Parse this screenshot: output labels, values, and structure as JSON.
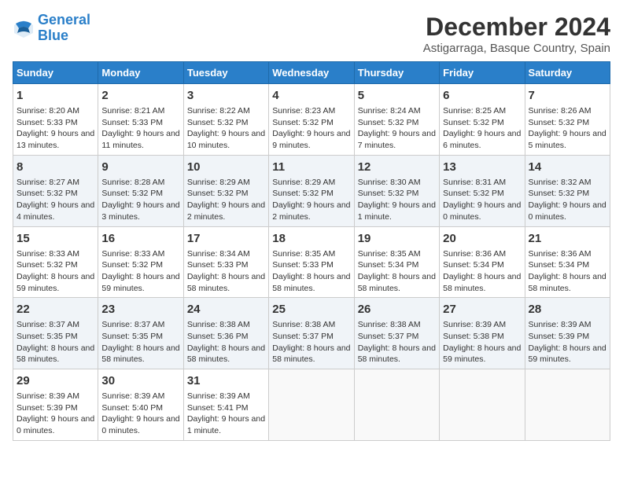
{
  "logo": {
    "line1": "General",
    "line2": "Blue"
  },
  "title": "December 2024",
  "subtitle": "Astigarraga, Basque Country, Spain",
  "headers": [
    "Sunday",
    "Monday",
    "Tuesday",
    "Wednesday",
    "Thursday",
    "Friday",
    "Saturday"
  ],
  "weeks": [
    [
      {
        "day": "1",
        "sunrise": "Sunrise: 8:20 AM",
        "sunset": "Sunset: 5:33 PM",
        "daylight": "Daylight: 9 hours and 13 minutes."
      },
      {
        "day": "2",
        "sunrise": "Sunrise: 8:21 AM",
        "sunset": "Sunset: 5:33 PM",
        "daylight": "Daylight: 9 hours and 11 minutes."
      },
      {
        "day": "3",
        "sunrise": "Sunrise: 8:22 AM",
        "sunset": "Sunset: 5:32 PM",
        "daylight": "Daylight: 9 hours and 10 minutes."
      },
      {
        "day": "4",
        "sunrise": "Sunrise: 8:23 AM",
        "sunset": "Sunset: 5:32 PM",
        "daylight": "Daylight: 9 hours and 9 minutes."
      },
      {
        "day": "5",
        "sunrise": "Sunrise: 8:24 AM",
        "sunset": "Sunset: 5:32 PM",
        "daylight": "Daylight: 9 hours and 7 minutes."
      },
      {
        "day": "6",
        "sunrise": "Sunrise: 8:25 AM",
        "sunset": "Sunset: 5:32 PM",
        "daylight": "Daylight: 9 hours and 6 minutes."
      },
      {
        "day": "7",
        "sunrise": "Sunrise: 8:26 AM",
        "sunset": "Sunset: 5:32 PM",
        "daylight": "Daylight: 9 hours and 5 minutes."
      }
    ],
    [
      {
        "day": "8",
        "sunrise": "Sunrise: 8:27 AM",
        "sunset": "Sunset: 5:32 PM",
        "daylight": "Daylight: 9 hours and 4 minutes."
      },
      {
        "day": "9",
        "sunrise": "Sunrise: 8:28 AM",
        "sunset": "Sunset: 5:32 PM",
        "daylight": "Daylight: 9 hours and 3 minutes."
      },
      {
        "day": "10",
        "sunrise": "Sunrise: 8:29 AM",
        "sunset": "Sunset: 5:32 PM",
        "daylight": "Daylight: 9 hours and 2 minutes."
      },
      {
        "day": "11",
        "sunrise": "Sunrise: 8:29 AM",
        "sunset": "Sunset: 5:32 PM",
        "daylight": "Daylight: 9 hours and 2 minutes."
      },
      {
        "day": "12",
        "sunrise": "Sunrise: 8:30 AM",
        "sunset": "Sunset: 5:32 PM",
        "daylight": "Daylight: 9 hours and 1 minute."
      },
      {
        "day": "13",
        "sunrise": "Sunrise: 8:31 AM",
        "sunset": "Sunset: 5:32 PM",
        "daylight": "Daylight: 9 hours and 0 minutes."
      },
      {
        "day": "14",
        "sunrise": "Sunrise: 8:32 AM",
        "sunset": "Sunset: 5:32 PM",
        "daylight": "Daylight: 9 hours and 0 minutes."
      }
    ],
    [
      {
        "day": "15",
        "sunrise": "Sunrise: 8:33 AM",
        "sunset": "Sunset: 5:32 PM",
        "daylight": "Daylight: 8 hours and 59 minutes."
      },
      {
        "day": "16",
        "sunrise": "Sunrise: 8:33 AM",
        "sunset": "Sunset: 5:32 PM",
        "daylight": "Daylight: 8 hours and 59 minutes."
      },
      {
        "day": "17",
        "sunrise": "Sunrise: 8:34 AM",
        "sunset": "Sunset: 5:33 PM",
        "daylight": "Daylight: 8 hours and 58 minutes."
      },
      {
        "day": "18",
        "sunrise": "Sunrise: 8:35 AM",
        "sunset": "Sunset: 5:33 PM",
        "daylight": "Daylight: 8 hours and 58 minutes."
      },
      {
        "day": "19",
        "sunrise": "Sunrise: 8:35 AM",
        "sunset": "Sunset: 5:34 PM",
        "daylight": "Daylight: 8 hours and 58 minutes."
      },
      {
        "day": "20",
        "sunrise": "Sunrise: 8:36 AM",
        "sunset": "Sunset: 5:34 PM",
        "daylight": "Daylight: 8 hours and 58 minutes."
      },
      {
        "day": "21",
        "sunrise": "Sunrise: 8:36 AM",
        "sunset": "Sunset: 5:34 PM",
        "daylight": "Daylight: 8 hours and 58 minutes."
      }
    ],
    [
      {
        "day": "22",
        "sunrise": "Sunrise: 8:37 AM",
        "sunset": "Sunset: 5:35 PM",
        "daylight": "Daylight: 8 hours and 58 minutes."
      },
      {
        "day": "23",
        "sunrise": "Sunrise: 8:37 AM",
        "sunset": "Sunset: 5:35 PM",
        "daylight": "Daylight: 8 hours and 58 minutes."
      },
      {
        "day": "24",
        "sunrise": "Sunrise: 8:38 AM",
        "sunset": "Sunset: 5:36 PM",
        "daylight": "Daylight: 8 hours and 58 minutes."
      },
      {
        "day": "25",
        "sunrise": "Sunrise: 8:38 AM",
        "sunset": "Sunset: 5:37 PM",
        "daylight": "Daylight: 8 hours and 58 minutes."
      },
      {
        "day": "26",
        "sunrise": "Sunrise: 8:38 AM",
        "sunset": "Sunset: 5:37 PM",
        "daylight": "Daylight: 8 hours and 58 minutes."
      },
      {
        "day": "27",
        "sunrise": "Sunrise: 8:39 AM",
        "sunset": "Sunset: 5:38 PM",
        "daylight": "Daylight: 8 hours and 59 minutes."
      },
      {
        "day": "28",
        "sunrise": "Sunrise: 8:39 AM",
        "sunset": "Sunset: 5:39 PM",
        "daylight": "Daylight: 8 hours and 59 minutes."
      }
    ],
    [
      {
        "day": "29",
        "sunrise": "Sunrise: 8:39 AM",
        "sunset": "Sunset: 5:39 PM",
        "daylight": "Daylight: 9 hours and 0 minutes."
      },
      {
        "day": "30",
        "sunrise": "Sunrise: 8:39 AM",
        "sunset": "Sunset: 5:40 PM",
        "daylight": "Daylight: 9 hours and 0 minutes."
      },
      {
        "day": "31",
        "sunrise": "Sunrise: 8:39 AM",
        "sunset": "Sunset: 5:41 PM",
        "daylight": "Daylight: 9 hours and 1 minute."
      },
      null,
      null,
      null,
      null
    ]
  ]
}
